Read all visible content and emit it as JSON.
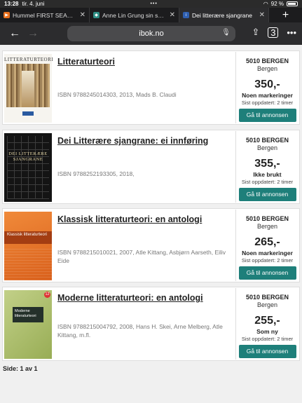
{
  "status_bar": {
    "time": "13:28",
    "date": "tir. 4. juni",
    "battery": "92 %"
  },
  "tabs": [
    {
      "title": "Hummel FIRST SEAMLESS",
      "favicon_color": "#e9701c",
      "active": false
    },
    {
      "title": "Anne Lin Grung sin selger",
      "favicon_color": "#2f8f86",
      "active": false
    },
    {
      "title": "Dei litterære sjangrane",
      "favicon_color": "#2f5fb0",
      "active": true
    }
  ],
  "toolbar": {
    "url": "ibok.no",
    "tab_count": "3"
  },
  "listings": [
    {
      "title": "Litteraturteori",
      "meta": "ISBN 9788245014303, 2013, Mads B. Claudi",
      "cover_text": "LITTERATURTEORI",
      "postal": "5010 BERGEN",
      "city": "Bergen",
      "price": "350,-",
      "condition": "Noen markeringer",
      "updated": "Sist oppdatert: 2 timer",
      "button": "Gå til annonsen"
    },
    {
      "title": "Dei Litterære sjangrane: ei innføring",
      "meta": "ISBN 9788252193305, 2018,",
      "cover_text": "DEI LITTERÆRE SJANGRANE",
      "postal": "5010 BERGEN",
      "city": "Bergen",
      "price": "355,-",
      "condition": "Ikke brukt",
      "updated": "Sist oppdatert: 2 timer",
      "button": "Gå til annonsen"
    },
    {
      "title": "Klassisk litteraturteori: en antologi",
      "meta": "ISBN 9788215010021, 2007, Atle Kittang, Asbjørn Aarseth, Eiliv Eide",
      "cover_text": "Klassisk litteraturteori",
      "postal": "5010 BERGEN",
      "city": "Bergen",
      "price": "265,-",
      "condition": "Noen markeringer",
      "updated": "Sist oppdatert: 2 timer",
      "button": "Gå til annonsen"
    },
    {
      "title": "Moderne litteraturteori: en antologi",
      "meta": "ISBN 9788215004792, 2008, Hans H. Skei, Arne Melberg, Atle Kittang, m.fl.",
      "cover_text": "Moderne litteraturteori",
      "postal": "5010 BERGEN",
      "city": "Bergen",
      "price": "255,-",
      "condition": "Som ny",
      "updated": "Sist oppdatert: 2 timer",
      "button": "Gå til annonsen"
    }
  ],
  "pager": {
    "label": "Side: 1 av 1"
  }
}
